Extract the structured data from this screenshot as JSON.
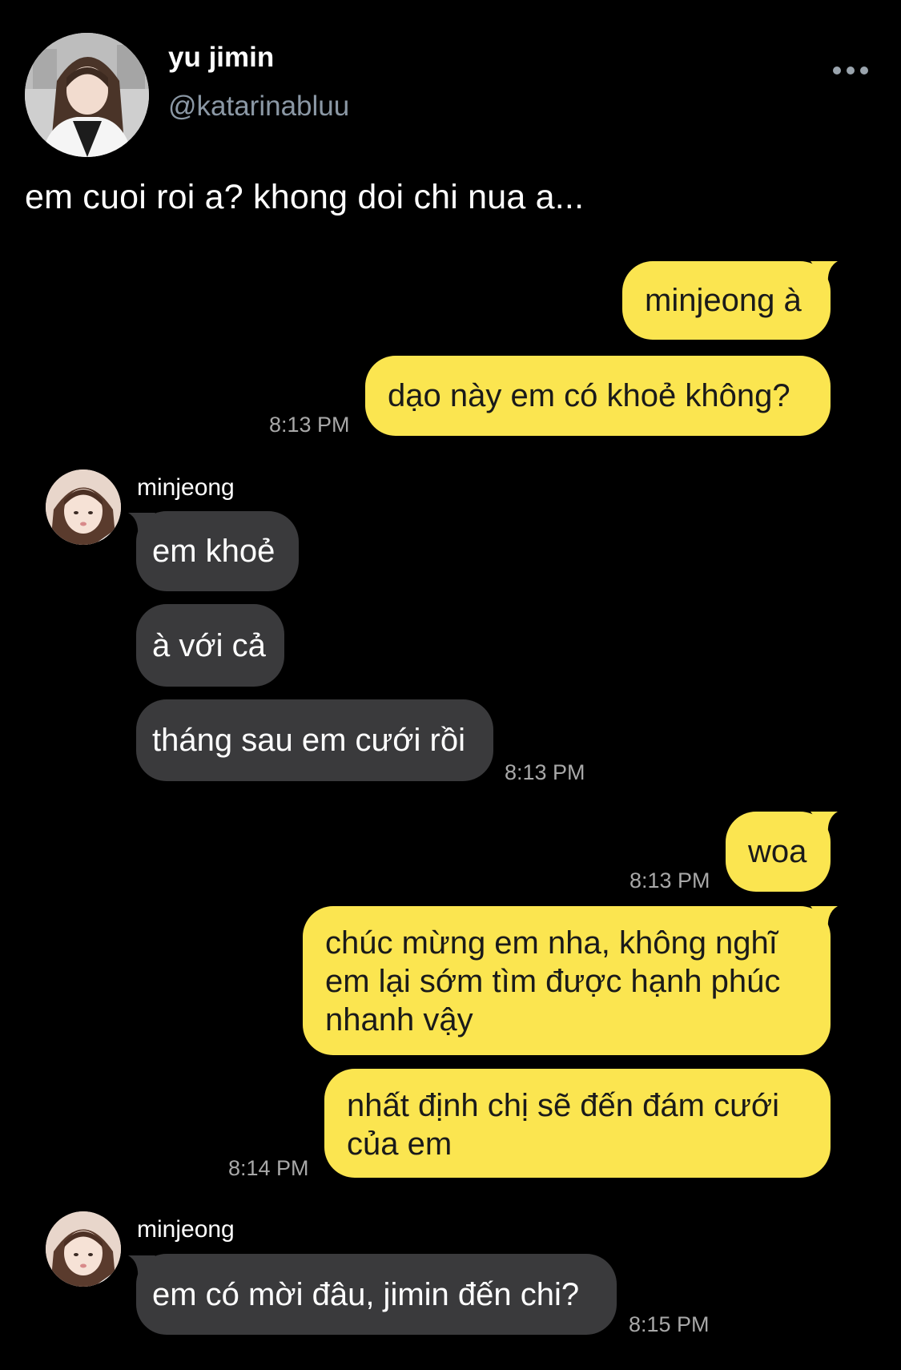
{
  "profile": {
    "display_name": "yu jimin",
    "handle": "@katarinabluu",
    "more_label": "More options"
  },
  "tweet": {
    "text": "em cuoi roi a? khong doi chi nua a..."
  },
  "colors": {
    "outgoing_bubble": "#fbe550",
    "incoming_bubble": "#3a3a3c",
    "background": "#000000",
    "handle_text": "#8b98a5",
    "timestamp": "#a8a8a8"
  },
  "chat": {
    "sender_name": "minjeong",
    "messages": [
      {
        "from": "me",
        "text": "minjeong à"
      },
      {
        "from": "me",
        "text": "dạo này em có khoẻ không?",
        "time": "8:13 PM"
      },
      {
        "from": "minjeong",
        "text": "em khoẻ"
      },
      {
        "from": "minjeong",
        "text": "à với cả"
      },
      {
        "from": "minjeong",
        "text": "tháng sau em cưới rồi",
        "time": "8:13 PM"
      },
      {
        "from": "me",
        "text": "woa",
        "time": "8:13 PM"
      },
      {
        "from": "me",
        "lines": [
          "chúc mừng em nha, không nghĩ",
          "em lại sớm tìm được hạnh phúc",
          "nhanh vậy"
        ]
      },
      {
        "from": "me",
        "lines": [
          "nhất định chị sẽ đến đám cưới",
          "của em"
        ],
        "time": "8:14 PM"
      },
      {
        "from": "minjeong",
        "text": "em có mời đâu, jimin đến chi?",
        "time": "8:15 PM"
      }
    ]
  }
}
